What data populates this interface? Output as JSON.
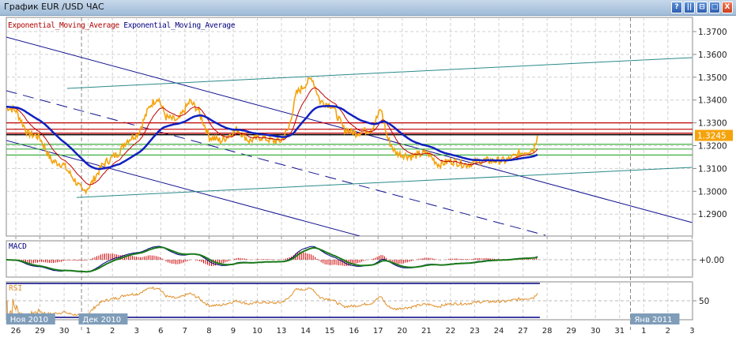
{
  "window": {
    "title": "График EUR /USD  ЧАС",
    "buttons": [
      "?",
      "||",
      "⊟",
      "□",
      "X"
    ]
  },
  "legend": {
    "ema_fast": "Exponential_Moving_Average",
    "ema_slow": "Exponential_Moving_Average"
  },
  "panels": {
    "macd_label": "MACD",
    "rsi_label": "RSI",
    "macd_tick": "+0.00",
    "rsi_tick": "50"
  },
  "colors": {
    "price": "#f5a30a",
    "ema_fast": "#c00000",
    "ema_slow": "#1020c0",
    "resistance": "#c00000",
    "support": "#40b040",
    "current": "#000000",
    "channel": "#101090",
    "trend_teal": "#2a8a8a",
    "price_tag": "#f5a30a",
    "macd_line": "#1a7a1a",
    "macd_hist": "#d00000",
    "rsi": "#e0902a",
    "month_tag": "#7f9db9"
  },
  "chart_data": {
    "type": "line",
    "title": "EUR/USD hourly",
    "ylim": [
      1.283,
      1.3762
    ],
    "y_ticks": [
      "1.3700",
      "1.3600",
      "1.3500",
      "1.3400",
      "1.3300",
      "1.3200",
      "1.3100",
      "1.3000",
      "1.2900"
    ],
    "y_tick_values": [
      1.37,
      1.36,
      1.35,
      1.34,
      1.33,
      1.32,
      1.31,
      1.3,
      1.29
    ],
    "current_price": "1.3245",
    "x_labels": [
      "26",
      "29",
      "30",
      "1",
      "2",
      "3",
      "6",
      "7",
      "8",
      "9",
      "10",
      "13",
      "14",
      "15",
      "16",
      "17",
      "20",
      "21",
      "22",
      "23",
      "24",
      "27",
      "28",
      "29",
      "30",
      "31",
      "1",
      "2",
      "3"
    ],
    "month_labels": [
      {
        "label": "Ноя 2010",
        "day": -0.4
      },
      {
        "label": "Дек 2010",
        "day": 2.6
      },
      {
        "label": "Янв 2011",
        "day": 25.45
      }
    ],
    "price": [
      [
        -0.4,
        1.3371
      ],
      [
        0,
        1.3354
      ],
      [
        0.49,
        1.3255
      ],
      [
        0.98,
        1.3238
      ],
      [
        1.47,
        1.3134
      ],
      [
        1.96,
        1.3117
      ],
      [
        2.45,
        1.3048
      ],
      [
        2.78,
        1.2996
      ],
      [
        3.11,
        1.3031
      ],
      [
        3.6,
        1.3117
      ],
      [
        4.26,
        1.3169
      ],
      [
        4.58,
        1.3221
      ],
      [
        5.07,
        1.3255
      ],
      [
        5.56,
        1.3377
      ],
      [
        5.89,
        1.3412
      ],
      [
        6.22,
        1.3325
      ],
      [
        6.71,
        1.3308
      ],
      [
        7.2,
        1.3394
      ],
      [
        7.53,
        1.336
      ],
      [
        8.02,
        1.3238
      ],
      [
        8.51,
        1.3221
      ],
      [
        9.17,
        1.3273
      ],
      [
        9.66,
        1.3221
      ],
      [
        10.15,
        1.3238
      ],
      [
        10.64,
        1.3221
      ],
      [
        10.97,
        1.3221
      ],
      [
        11.29,
        1.3273
      ],
      [
        11.62,
        1.3429
      ],
      [
        12.27,
        1.3498
      ],
      [
        12.6,
        1.3394
      ],
      [
        13.09,
        1.3377
      ],
      [
        13.58,
        1.3273
      ],
      [
        14.08,
        1.3255
      ],
      [
        14.73,
        1.3273
      ],
      [
        15.12,
        1.336
      ],
      [
        15.38,
        1.3238
      ],
      [
        15.71,
        1.3169
      ],
      [
        16.37,
        1.3152
      ],
      [
        17.02,
        1.3169
      ],
      [
        17.51,
        1.3117
      ],
      [
        18.0,
        1.3134
      ],
      [
        18.66,
        1.3117
      ],
      [
        19.31,
        1.3134
      ],
      [
        20.29,
        1.3134
      ],
      [
        20.95,
        1.3169
      ],
      [
        21.44,
        1.3186
      ],
      [
        21.6,
        1.3245
      ]
    ],
    "levels": [
      {
        "type": "resistance",
        "price": 1.33
      },
      {
        "type": "resistance",
        "price": 1.3272
      },
      {
        "type": "resistance",
        "price": 1.3255
      },
      {
        "type": "current",
        "price": 1.3248
      },
      {
        "type": "support",
        "price": 1.3206
      },
      {
        "type": "support",
        "price": 1.3185
      },
      {
        "type": "support",
        "price": 1.3159
      }
    ],
    "trendlines": [
      {
        "type": "channel",
        "style": "solid",
        "from": [
          -0.4,
          1.3676
        ],
        "to": [
          28.0,
          1.2863
        ]
      },
      {
        "type": "channel",
        "style": "solid",
        "from": [
          -0.4,
          1.3223
        ],
        "to": [
          14.24,
          1.2804
        ]
      },
      {
        "type": "channel",
        "style": "dashed",
        "from": [
          -0.4,
          1.3441
        ],
        "to": [
          21.93,
          1.2807
        ]
      },
      {
        "type": "trend_teal",
        "style": "solid",
        "from": [
          2.13,
          1.3451
        ],
        "to": [
          28.0,
          1.3586
        ]
      },
      {
        "type": "trend_teal",
        "style": "solid",
        "from": [
          2.52,
          1.2973
        ],
        "to": [
          28.0,
          1.3105
        ]
      }
    ],
    "separators": [
      2.72,
      25.45
    ]
  }
}
